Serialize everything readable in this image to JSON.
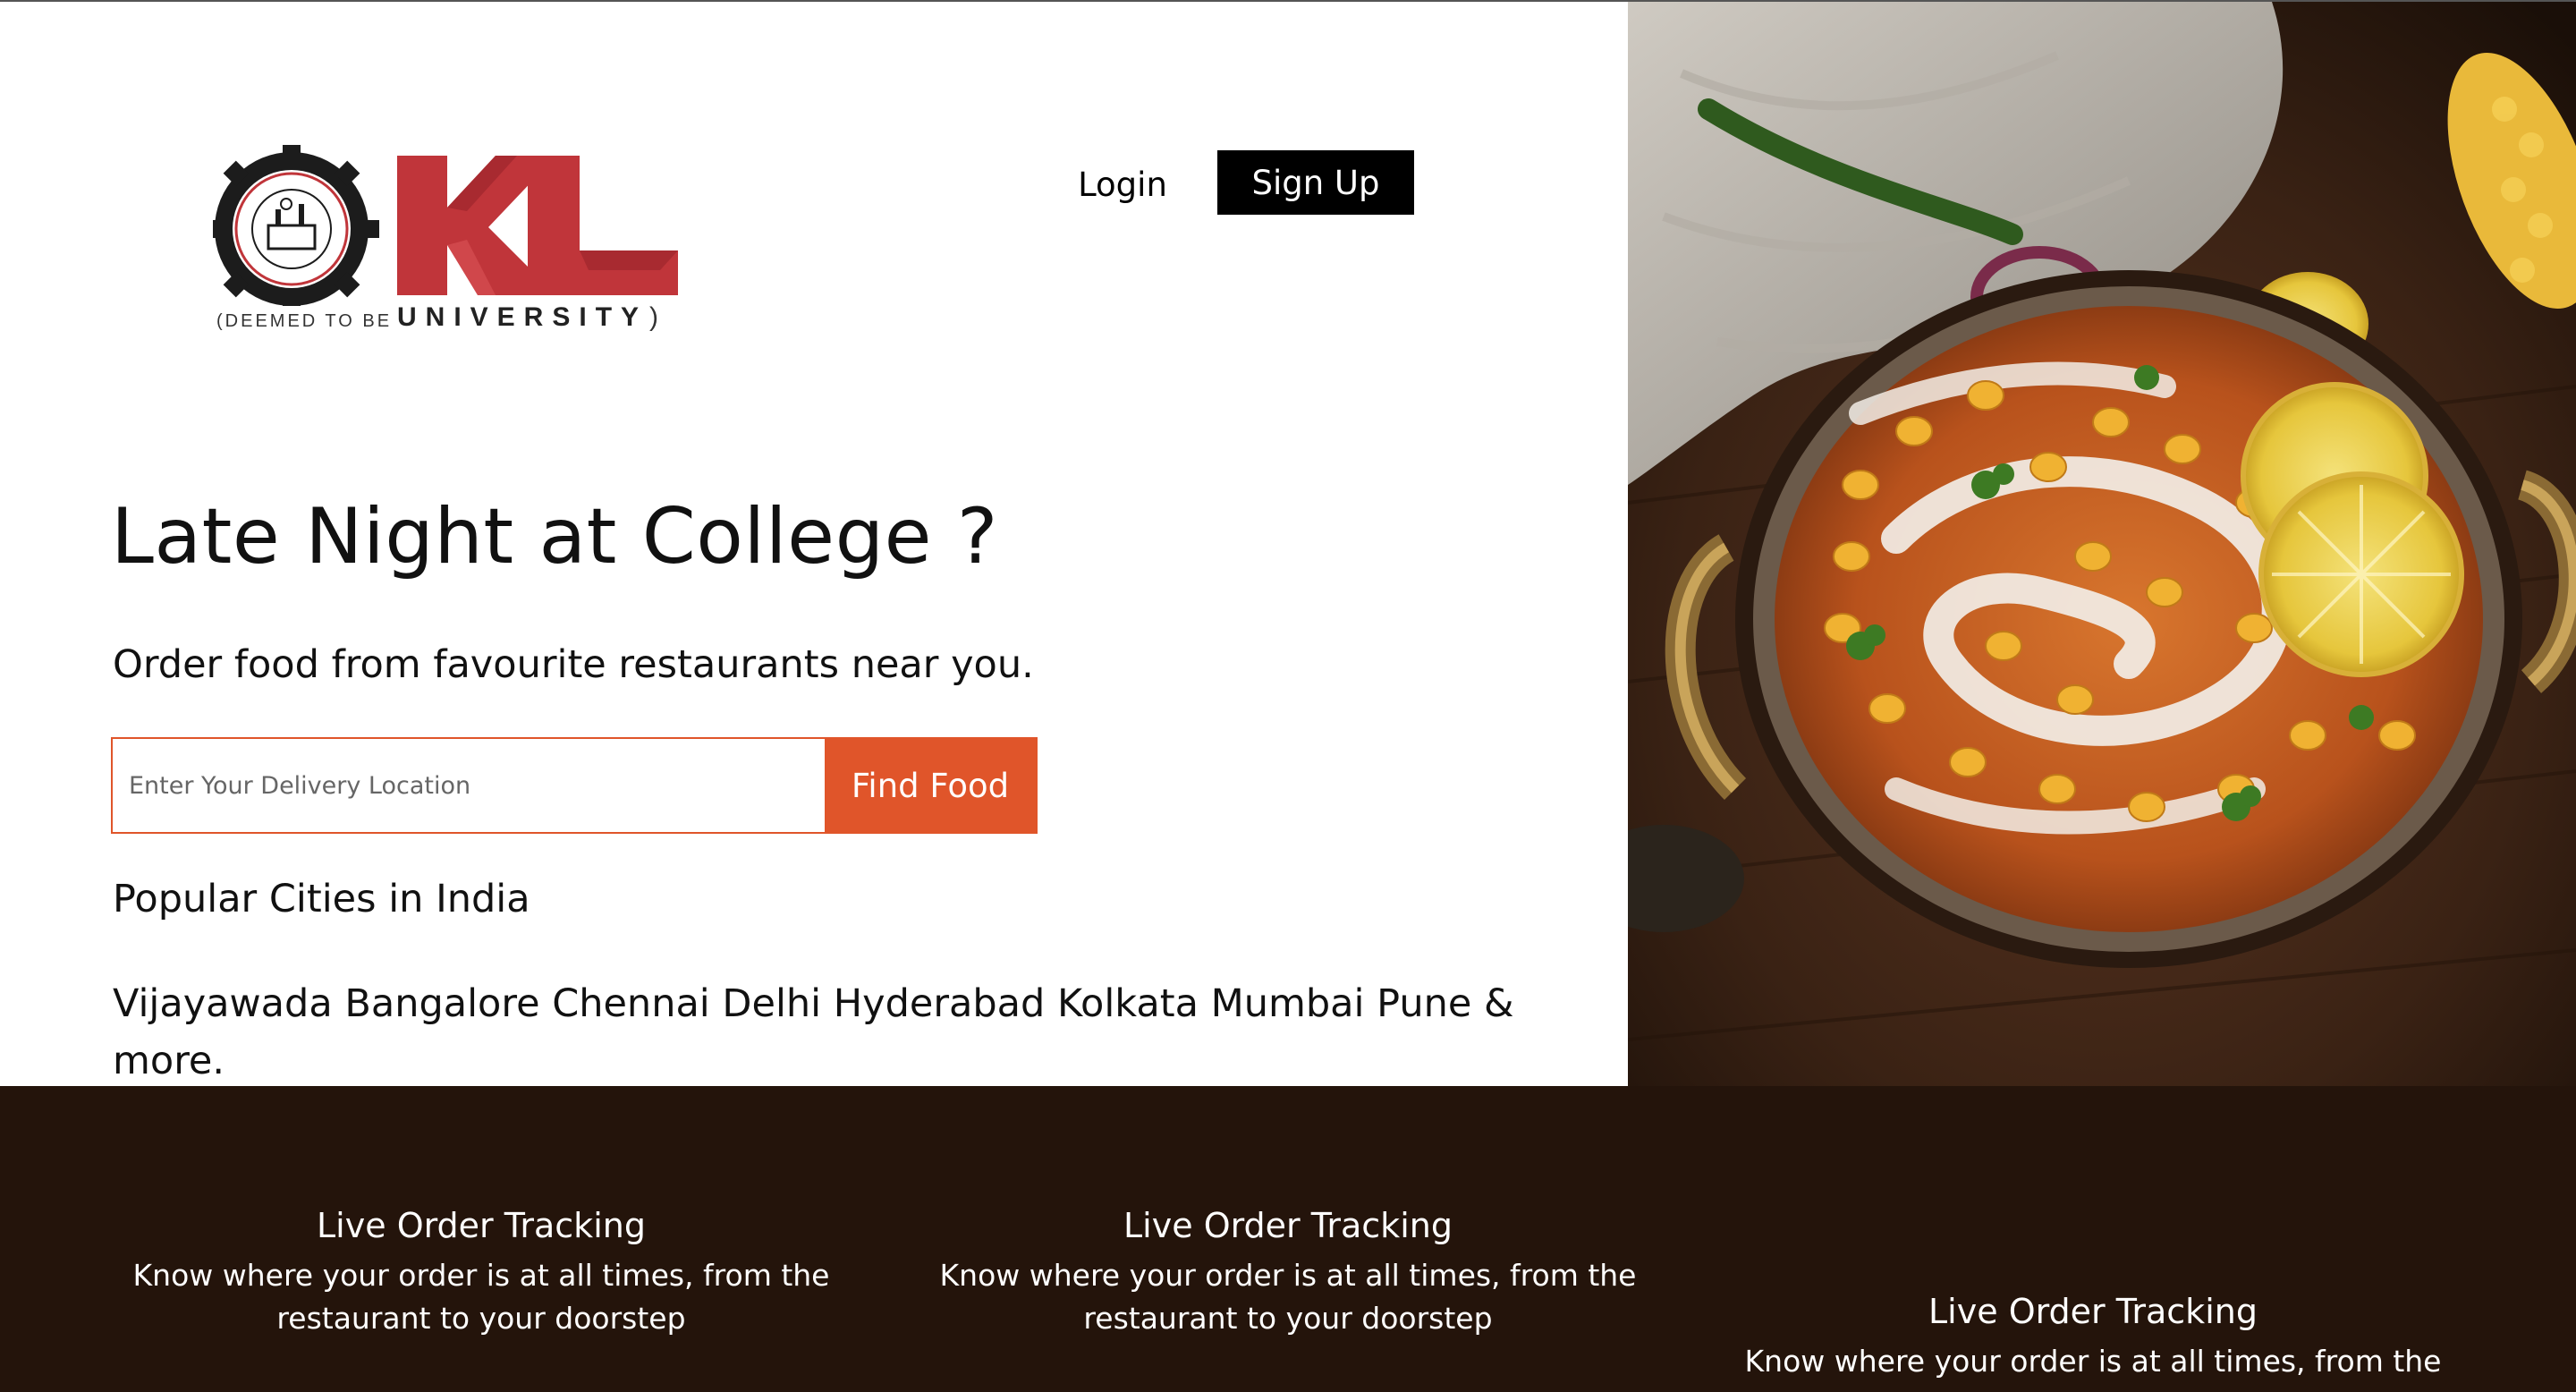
{
  "logo": {
    "caption": "(DEEMED TO BE",
    "university": "UNIVERSITY",
    "closing_paren": ")",
    "brand_color": "#c0353a"
  },
  "nav": {
    "login_label": "Login",
    "signup_label": "Sign Up"
  },
  "hero": {
    "title": "Late Night at College ?",
    "subtitle": "Order food from favourite restaurants near you.",
    "search_placeholder": "Enter Your Delivery Location",
    "search_button": "Find Food",
    "accent_color": "#e0552a"
  },
  "popular": {
    "title": "Popular Cities in India",
    "cities": "Vijayawada Bangalore Chennai Delhi Hyderabad Kolkata Mumbai Pune & more."
  },
  "features": [
    {
      "title": "Live Order Tracking",
      "desc": "Know where your order is at all times, from the restaurant to your doorstep"
    },
    {
      "title": "Live Order Tracking",
      "desc": "Know where your order is at all times, from the restaurant to your doorstep"
    },
    {
      "title": "Live Order Tracking",
      "desc": "Know where your order is at all times, from the"
    }
  ],
  "colors": {
    "feature_band": "#24140b"
  }
}
